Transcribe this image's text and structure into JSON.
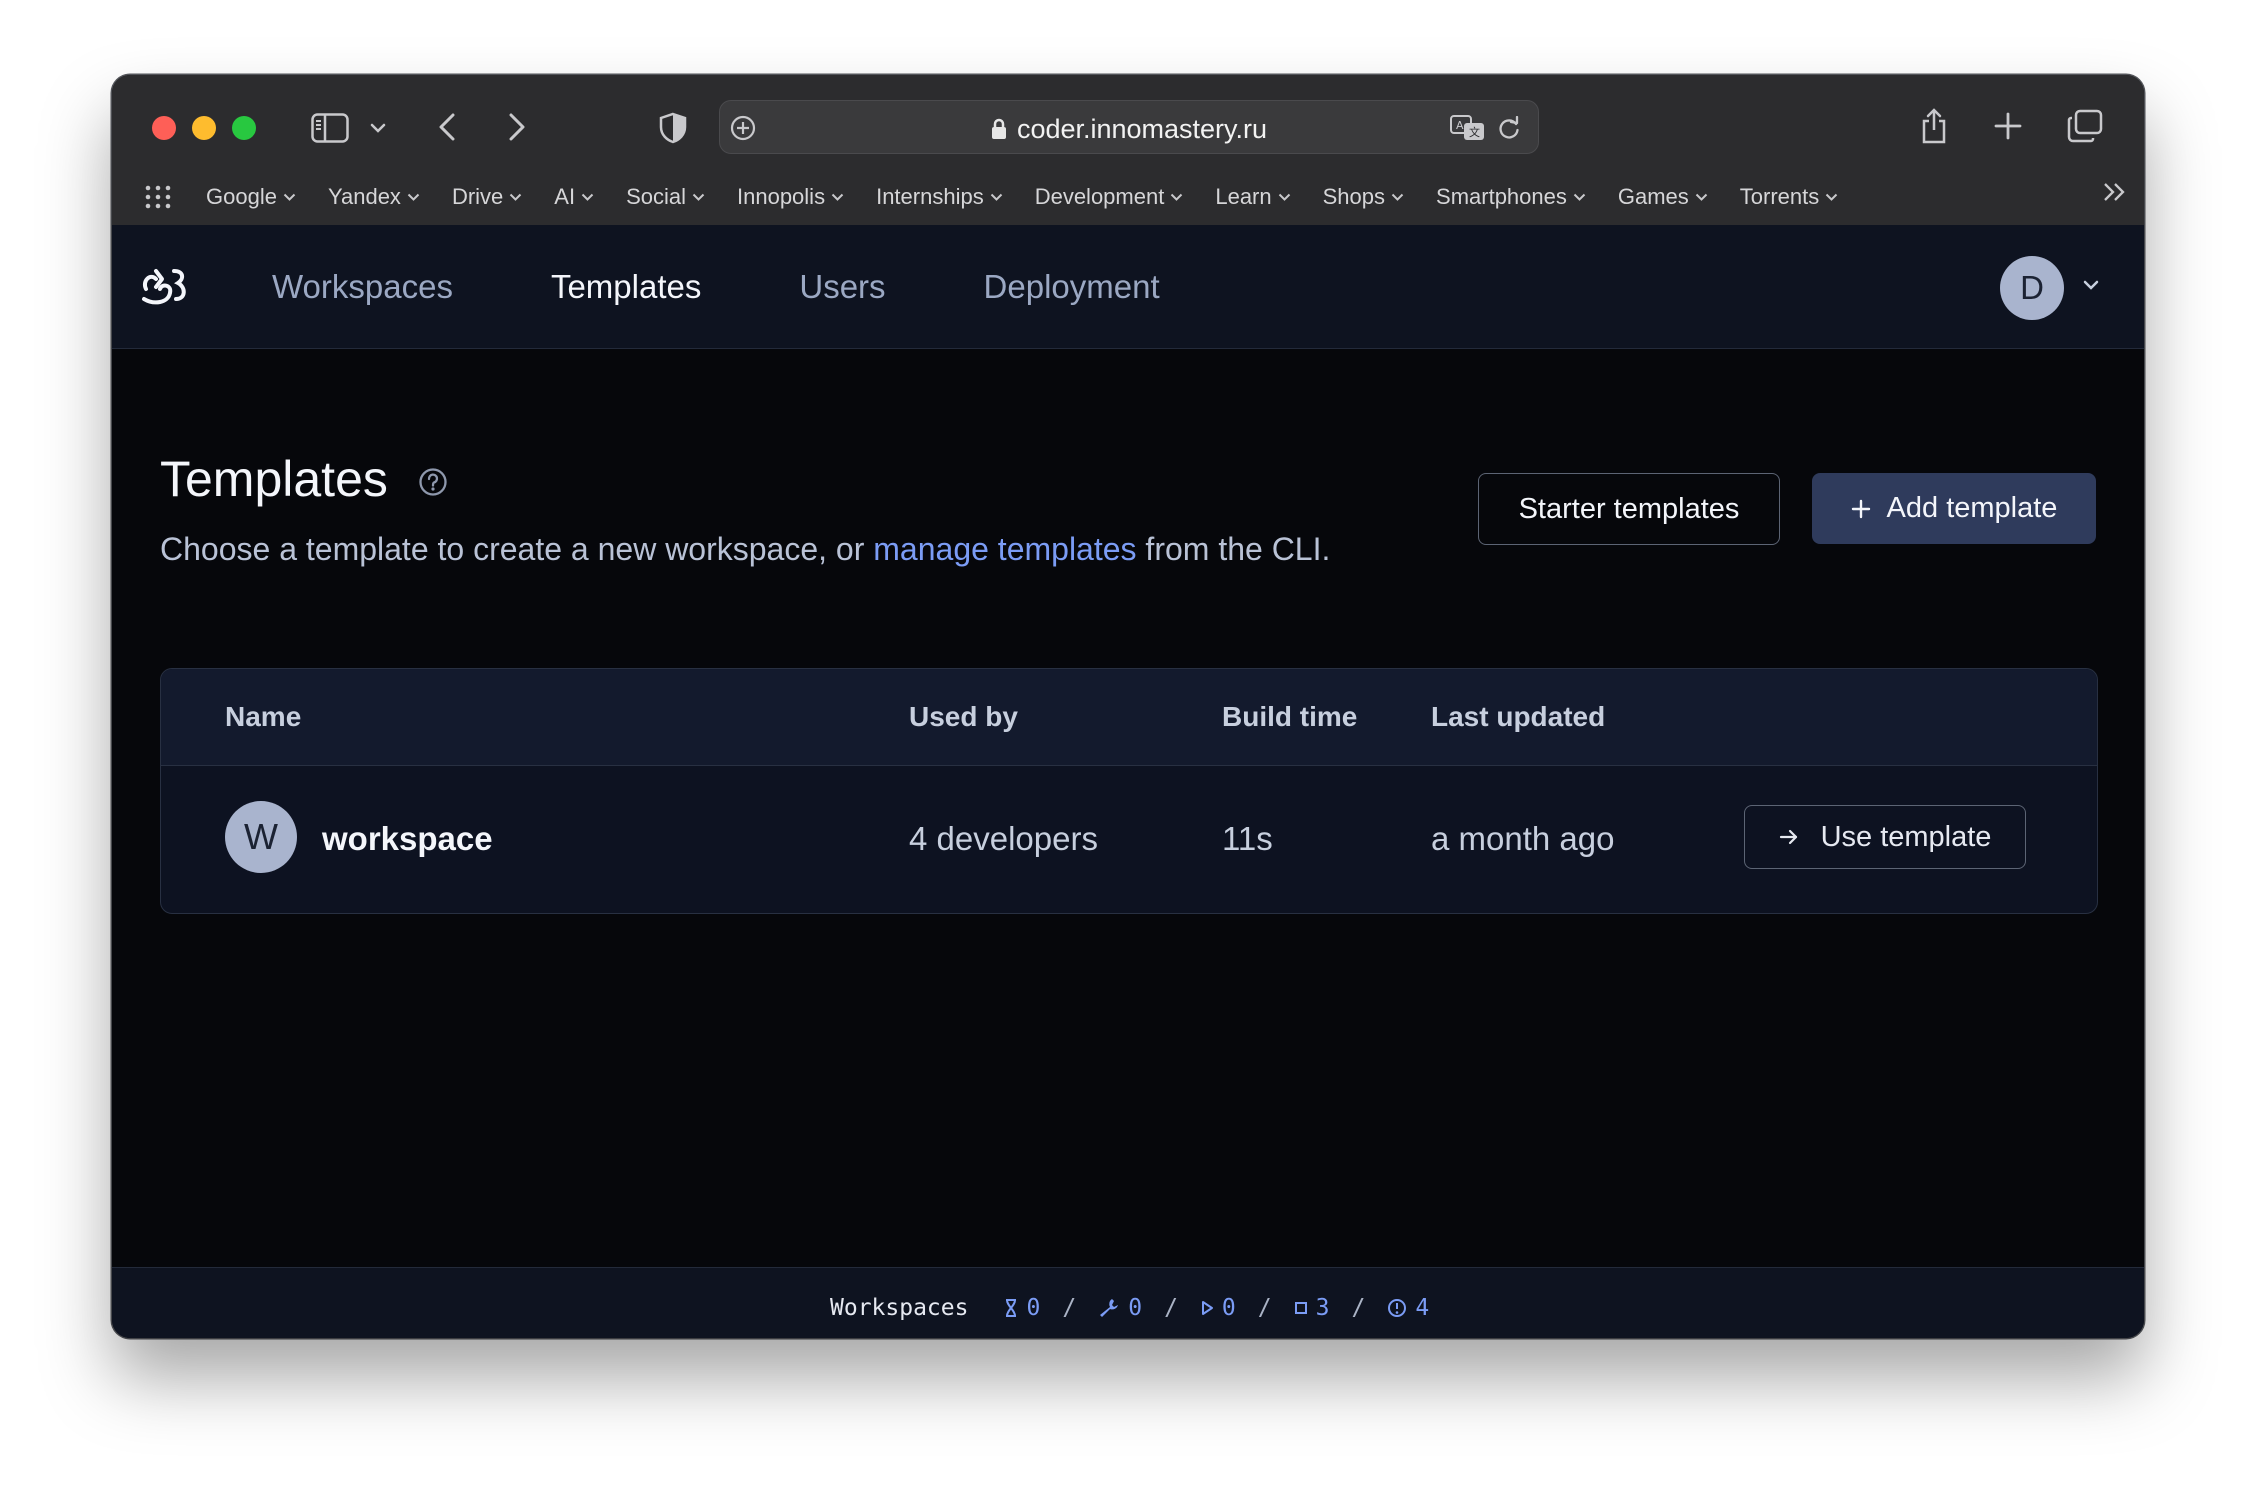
{
  "browser": {
    "url": "coder.innomastery.ru",
    "bookmarks": [
      "Google",
      "Yandex",
      "Drive",
      "AI",
      "Social",
      "Innopolis",
      "Internships",
      "Development",
      "Learn",
      "Shops",
      "Smartphones",
      "Games",
      "Torrents"
    ]
  },
  "nav": {
    "links": [
      "Workspaces",
      "Templates",
      "Users",
      "Deployment"
    ],
    "active": "Templates",
    "avatar_letter": "D"
  },
  "page": {
    "title": "Templates",
    "subtitle_before": "Choose a template to create a new workspace, or ",
    "subtitle_link": "manage templates",
    "subtitle_after": " from the CLI.",
    "starter_button": "Starter templates",
    "add_button": "Add template"
  },
  "table": {
    "columns": [
      "Name",
      "Used by",
      "Build time",
      "Last updated"
    ],
    "rows": [
      {
        "avatar": "W",
        "name": "workspace",
        "used_by": "4 developers",
        "build_time": "11s",
        "last_updated": "a month ago",
        "action": "Use template"
      }
    ]
  },
  "status": {
    "label": "Workspaces",
    "pending": "0",
    "starting": "0",
    "running": "0",
    "stopped": "3",
    "outdated": "4",
    "separator": "/"
  },
  "colors": {
    "accent": "#7b9cf5",
    "background": "#06070b",
    "nav_background": "#0e1320",
    "primary_button": "#2f3b5c"
  }
}
